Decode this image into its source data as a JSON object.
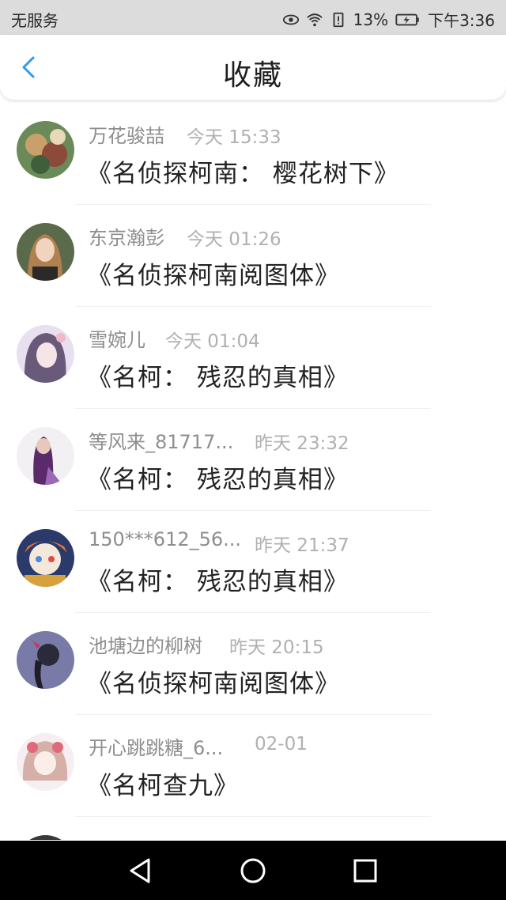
{
  "status_bar": {
    "carrier": "无服务",
    "battery": "13%",
    "time": "下午3:36",
    "icons": [
      "eye-icon",
      "wifi-icon",
      "battery-alert-icon",
      "battery-charging-icon"
    ]
  },
  "header": {
    "title": "收藏",
    "back_icon": "chevron-left-icon",
    "accent_color": "#2f9be8"
  },
  "items": [
    {
      "name": "万花骏喆",
      "time": "今天 15:33",
      "subject": "《名侦探柯南： 樱花树下》"
    },
    {
      "name": "东京瀚彭",
      "time": "今天 01:26",
      "subject": "《名侦探柯南阅图体》"
    },
    {
      "name": "雪婉儿",
      "time": "今天 01:04",
      "subject": "《名柯： 残忍的真相》"
    },
    {
      "name": "等风来_81717...",
      "time": "昨天 23:32",
      "subject": "《名柯： 残忍的真相》"
    },
    {
      "name": "150***612_56...",
      "time": "昨天 21:37",
      "subject": "《名柯： 残忍的真相》"
    },
    {
      "name": "池塘边的柳树",
      "time": "昨天 20:15",
      "subject": "《名侦探柯南阅图体》"
    },
    {
      "name": "开心跳跳糖_6...",
      "time": "02-01",
      "subject": "《名柯查九》"
    }
  ],
  "nav_bar": {
    "icons": [
      "back-triangle-icon",
      "home-circle-icon",
      "recents-square-icon"
    ]
  }
}
